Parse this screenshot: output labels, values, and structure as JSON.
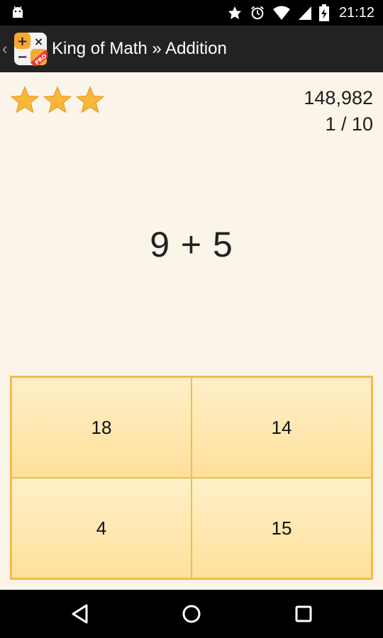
{
  "status_bar": {
    "time": "21:12",
    "icons": [
      "android-icon",
      "star-icon",
      "alarm-icon",
      "wifi-icon",
      "signal-icon",
      "battery-charging-icon"
    ]
  },
  "action_bar": {
    "title": "King of Math » Addition",
    "app_icon": "king-of-math-pro-icon",
    "app_icon_badge": "PRO"
  },
  "game": {
    "stars": {
      "earned": 3,
      "max": 3
    },
    "score": "148,982",
    "progress": "1 / 10",
    "problem": "9 + 5",
    "answers": [
      "18",
      "14",
      "4",
      "15"
    ]
  },
  "colors": {
    "background": "#fbf4e9",
    "star": "#f8b63a",
    "answer_border": "#f4bb45",
    "answer_fill": "#ffe7ad",
    "action_bar": "#222222"
  },
  "nav_bar": {
    "icons": [
      "back-icon",
      "home-icon",
      "recents-icon"
    ]
  }
}
